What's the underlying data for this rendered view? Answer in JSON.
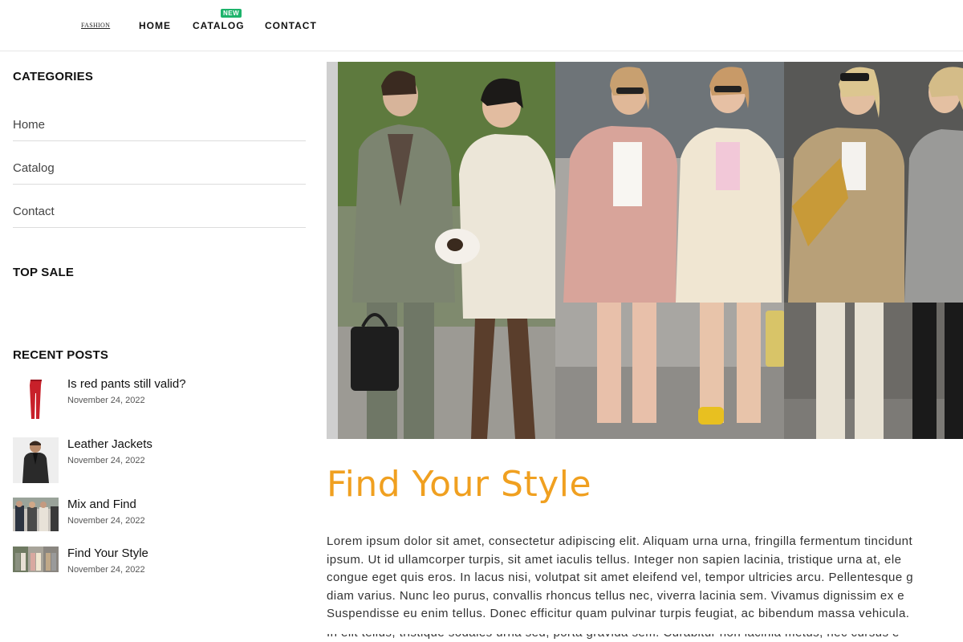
{
  "header": {
    "logo": "FASHION",
    "nav": [
      {
        "label": "HOME"
      },
      {
        "label": "CATALOG",
        "badge": "NEW"
      },
      {
        "label": "CONTACT"
      }
    ],
    "badge_color": "#1db36b"
  },
  "sidebar": {
    "categories_heading": "CATEGORIES",
    "categories": [
      {
        "label": "Home"
      },
      {
        "label": "Catalog"
      },
      {
        "label": "Contact"
      }
    ],
    "top_sale_heading": "TOP SALE",
    "recent_posts_heading": "RECENT POSTS",
    "recent_posts": [
      {
        "title": "Is red pants still valid?",
        "date": "November 24, 2022",
        "thumb": "red-pants-icon"
      },
      {
        "title": "Leather Jackets",
        "date": "November 24, 2022",
        "thumb": "leather-jacket-icon"
      },
      {
        "title": "Mix and Find",
        "date": "November 24, 2022",
        "thumb": "street-style-group-icon"
      },
      {
        "title": "Find Your Style",
        "date": "November 24, 2022",
        "thumb": "street-style-collage-icon"
      }
    ]
  },
  "main": {
    "title": "Find Your Style",
    "title_color": "#f0a020",
    "body_lines": [
      "Lorem ipsum dolor sit amet, consectetur adipiscing elit. Aliquam urna urna, fringilla fermentum tincidunt",
      "ipsum. Ut id ullamcorper turpis, sit amet iaculis tellus. Integer non sapien lacinia, tristique urna at, ele",
      "congue eget quis eros. In lacus nisi, volutpat sit amet eleifend vel, tempor ultricies arcu. Pellentesque g",
      "diam varius. Nunc leo purus, convallis rhoncus tellus nec, viverra lacinia sem. Vivamus dignissim ex e",
      "Suspendisse eu enim tellus. Donec efficitur quam pulvinar turpis feugiat, ac bibendum massa vehicula."
    ],
    "body_cut_line": "In elit tellus, tristique sodales urna sed, porta gravida sem. Curabitur non lacinia metus, nec cursus e"
  }
}
